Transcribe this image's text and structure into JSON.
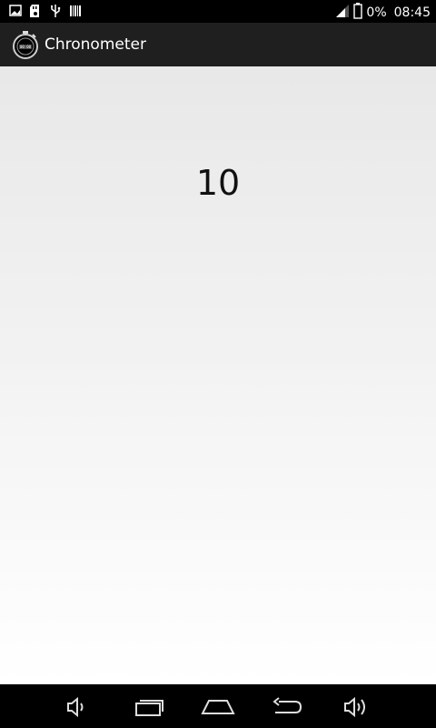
{
  "status_bar": {
    "battery_percent": "0%",
    "time": "08:45",
    "icons": [
      "image-notification-icon",
      "sd-card-icon",
      "usb-icon",
      "barcode-icon",
      "signal-icon",
      "battery-icon"
    ]
  },
  "action_bar": {
    "title": "Chronometer",
    "app_icon": "stopwatch-icon"
  },
  "main": {
    "counter_value": "10"
  },
  "nav_bar": {
    "buttons": [
      "volume-down-icon",
      "recent-apps-icon",
      "home-icon",
      "back-icon",
      "volume-up-icon"
    ]
  }
}
